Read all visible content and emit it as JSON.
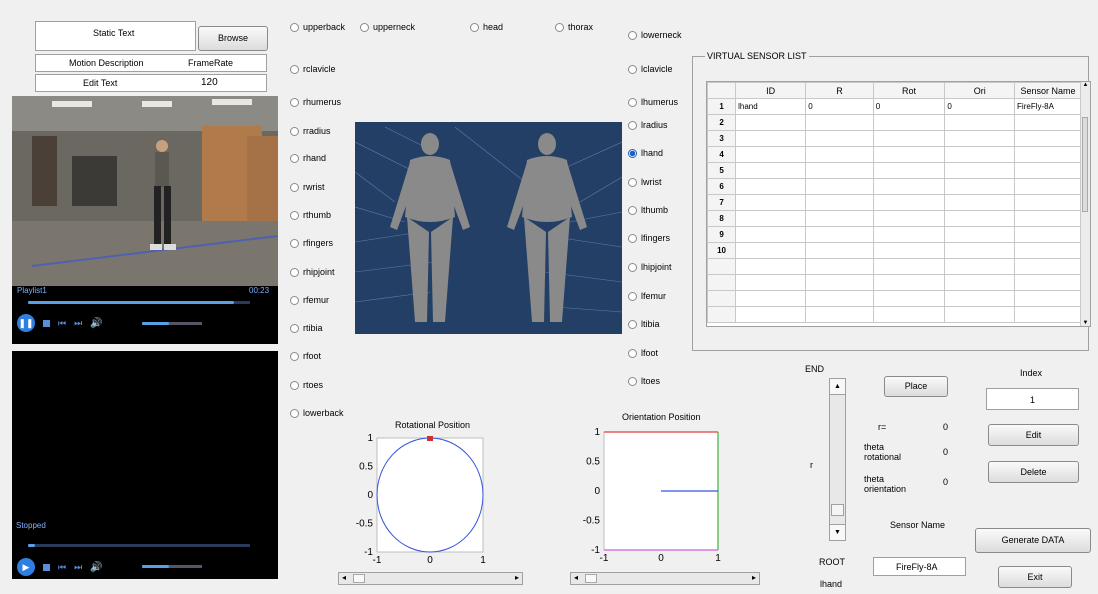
{
  "top_panel": {
    "static_text": "Static Text",
    "browse_label": "Browse",
    "motion_description": "Motion Description",
    "frame_rate_label": "FrameRate",
    "edit_text": "Edit Text",
    "frame_rate_value": "120"
  },
  "player1": {
    "playlist": "Playlist1",
    "time": "00:23",
    "progress": 0.93,
    "volume": 0.45
  },
  "player2": {
    "status": "Stopped",
    "progress": 0.03,
    "volume": 0.45
  },
  "joints_left": [
    "upperback",
    "upperneck",
    "head",
    "thorax",
    "rclavicle",
    "rhumerus",
    "rradius",
    "rhand",
    "rwrist",
    "rthumb",
    "rfingers",
    "rhipjoint",
    "rfemur",
    "rtibia",
    "rfoot",
    "rtoes",
    "lowerback"
  ],
  "joints_right": [
    "lowerneck",
    "lclavicle",
    "lhumerus",
    "lradius",
    "lhand",
    "lwrist",
    "lthumb",
    "lfingers",
    "lhipjoint",
    "lfemur",
    "ltibia",
    "lfoot",
    "ltoes"
  ],
  "selected_joint": "lhand",
  "sensor_list": {
    "title": "VIRTUAL SENSOR LIST",
    "columns": [
      "ID",
      "R",
      "Rot",
      "Ori",
      "Sensor Name"
    ],
    "row_numbers": [
      "1",
      "2",
      "3",
      "4",
      "5",
      "6",
      "7",
      "8",
      "9",
      "10"
    ],
    "rows": [
      [
        "lhand",
        "0",
        "0",
        "0",
        "FireFly-8A"
      ]
    ]
  },
  "rot_plot": {
    "title": "Rotational Position",
    "yticks": [
      "1",
      "0.5",
      "0",
      "-0.5",
      "-1"
    ],
    "xticks": [
      "-1",
      "0",
      "1"
    ]
  },
  "ori_plot": {
    "title": "Orientation Position",
    "yticks": [
      "1",
      "0.5",
      "0",
      "-0.5",
      "-1"
    ],
    "xticks": [
      "-1",
      "0",
      "1"
    ]
  },
  "controls": {
    "end_label": "END",
    "r_label": "r",
    "root_label": "ROOT",
    "lhand_label": "lhand",
    "place_label": "Place",
    "r_eq": "r=",
    "r_val": "0",
    "theta_rot": "theta rotational",
    "theta_rot_val": "0",
    "theta_ori": "theta orientation",
    "theta_ori_val": "0",
    "sensor_name_label": "Sensor Name",
    "sensor_name_value": "FireFly-8A",
    "index_label": "Index",
    "index_value": "1",
    "edit_label": "Edit",
    "delete_label": "Delete",
    "generate_label": "Generate DATA",
    "exit_label": "Exit"
  }
}
